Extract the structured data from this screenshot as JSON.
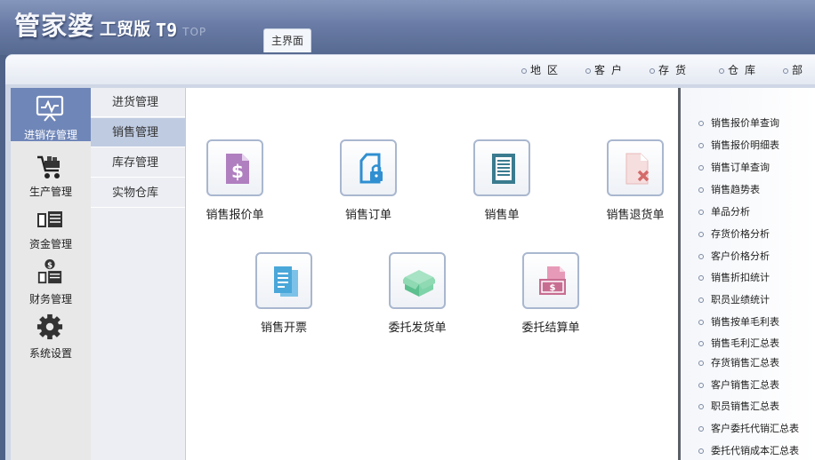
{
  "header": {
    "logo_main": "管家婆",
    "logo_edition": "工贸版",
    "logo_version": "T9",
    "logo_suffix": "TOP",
    "main_tab": "主界面"
  },
  "shortcuts": [
    "地区",
    "客户",
    "存货",
    "仓库",
    "部"
  ],
  "left_nav": [
    {
      "label": "进销存管理",
      "icon": "monitor-chart-icon",
      "active": true
    },
    {
      "label": "生产管理",
      "icon": "cart-icon",
      "active": false
    },
    {
      "label": "资金管理",
      "icon": "money-stack-icon",
      "active": false
    },
    {
      "label": "财务管理",
      "icon": "coin-stack-icon",
      "active": false
    },
    {
      "label": "系统设置",
      "icon": "gear-icon",
      "active": false
    }
  ],
  "submenu": [
    {
      "label": "进货管理",
      "active": false
    },
    {
      "label": "销售管理",
      "active": true
    },
    {
      "label": "库存管理",
      "active": false
    },
    {
      "label": "实物仓库",
      "active": false
    }
  ],
  "functions": [
    {
      "label": "销售报价单",
      "icon": "price-doc-icon"
    },
    {
      "label": "销售订单",
      "icon": "locked-doc-icon"
    },
    {
      "label": "销售单",
      "icon": "list-doc-icon"
    },
    {
      "label": "销售退货单",
      "icon": "cancel-doc-icon"
    },
    {
      "label": "销售开票",
      "icon": "invoice-doc-icon"
    },
    {
      "label": "委托发货单",
      "icon": "box-icon"
    },
    {
      "label": "委托结算单",
      "icon": "settlement-icon"
    }
  ],
  "reports": [
    "销售报价单查询",
    "销售报价明细表",
    "销售订单查询",
    "销售趋势表",
    "单品分析",
    "存货价格分析",
    "客户价格分析",
    "销售折扣统计",
    "职员业绩统计",
    "销售按单毛利表",
    "销售毛利汇总表",
    "存货销售汇总表",
    "客户销售汇总表",
    "职员销售汇总表",
    "客户委托代销汇总表",
    "委托代销成本汇总表"
  ],
  "colors": {
    "banner": "#6a7ca6",
    "nav_active": "#6f86b8",
    "submenu_active": "#bfcbe1",
    "icon_border": "#a9b7cf"
  }
}
